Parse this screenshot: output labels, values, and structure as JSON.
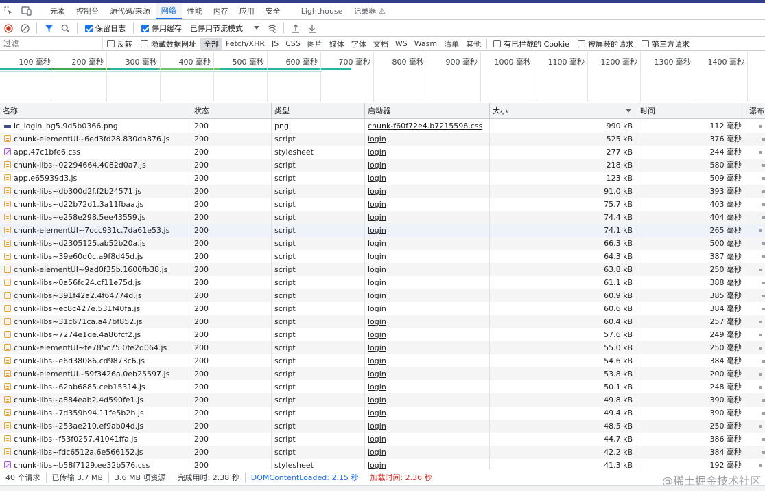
{
  "tabs": [
    {
      "label": "元素",
      "active": false
    },
    {
      "label": "控制台",
      "active": false
    },
    {
      "label": "源代码/来源",
      "active": false
    },
    {
      "label": "网络",
      "active": true
    },
    {
      "label": "性能",
      "active": false
    },
    {
      "label": "内存",
      "active": false
    },
    {
      "label": "应用",
      "active": false
    },
    {
      "label": "安全",
      "active": false
    },
    {
      "label": "Lighthouse",
      "active": false
    },
    {
      "label": "记录器 ⚠",
      "active": false
    }
  ],
  "toolbar": {
    "preserve_log": "保留日志",
    "disable_cache": "停用缓存",
    "throttle": "已停用节流模式"
  },
  "filter": {
    "placeholder": "过滤",
    "invert": "反转",
    "hide_data_urls": "隐藏数据网址",
    "types": [
      "全部",
      "Fetch/XHR",
      "JS",
      "CSS",
      "图片",
      "媒体",
      "字体",
      "文档",
      "WS",
      "Wasm",
      "清单",
      "其他"
    ],
    "active_type": "全部",
    "blocked_cookies": "有已拦截的 Cookie",
    "blocked_requests": "被屏蔽的请求",
    "third_party": "第三方请求"
  },
  "overview": {
    "ticks": [
      "100 毫秒",
      "200 毫秒",
      "300 毫秒",
      "400 毫秒",
      "500 毫秒",
      "600 毫秒",
      "700 毫秒",
      "800 毫秒",
      "900 毫秒",
      "1000 毫秒",
      "1100 毫秒",
      "1200 毫秒",
      "1300 毫秒",
      "1400 毫秒"
    ]
  },
  "columns": {
    "name": "名称",
    "status": "状态",
    "type": "类型",
    "initiator": "启动器",
    "size": "大小",
    "time": "时间",
    "waterfall": "瀑布"
  },
  "rows": [
    {
      "name": "ic_login_bg5.9d5b0366.png",
      "status": "200",
      "type": "png",
      "initiator": "chunk-f60f72e4.b7215596.css",
      "size": "990 kB",
      "time": "112 毫秒"
    },
    {
      "name": "chunk-elementUI~6ed3fd28.830da876.js",
      "status": "200",
      "type": "script",
      "initiator": "login",
      "size": "525 kB",
      "time": "376 毫秒"
    },
    {
      "name": "app.47c1bfe6.css",
      "status": "200",
      "type": "stylesheet",
      "initiator": "login",
      "size": "277 kB",
      "time": "244 毫秒"
    },
    {
      "name": "chunk-libs~02294664.4082d0a7.js",
      "status": "200",
      "type": "script",
      "initiator": "login",
      "size": "218 kB",
      "time": "580 毫秒"
    },
    {
      "name": "app.e65939d3.js",
      "status": "200",
      "type": "script",
      "initiator": "login",
      "size": "123 kB",
      "time": "509 毫秒"
    },
    {
      "name": "chunk-libs~db300d2f.f2b24571.js",
      "status": "200",
      "type": "script",
      "initiator": "login",
      "size": "91.0 kB",
      "time": "393 毫秒"
    },
    {
      "name": "chunk-libs~d22b72d1.3a11fbaa.js",
      "status": "200",
      "type": "script",
      "initiator": "login",
      "size": "75.7 kB",
      "time": "403 毫秒"
    },
    {
      "name": "chunk-libs~e258e298.5ee43559.js",
      "status": "200",
      "type": "script",
      "initiator": "login",
      "size": "74.4 kB",
      "time": "404 毫秒"
    },
    {
      "name": "chunk-elementUI~7occ931c.7da61e53.js",
      "status": "200",
      "type": "script",
      "initiator": "login",
      "size": "74.1 kB",
      "time": "265 毫秒"
    },
    {
      "name": "chunk-libs~d2305125.ab52b20a.js",
      "status": "200",
      "type": "script",
      "initiator": "login",
      "size": "66.3 kB",
      "time": "500 毫秒"
    },
    {
      "name": "chunk-libs~39e60d0c.a9f8d45d.js",
      "status": "200",
      "type": "script",
      "initiator": "login",
      "size": "64.3 kB",
      "time": "387 毫秒"
    },
    {
      "name": "chunk-elementUI~9ad0f35b.1600fb38.js",
      "status": "200",
      "type": "script",
      "initiator": "login",
      "size": "63.8 kB",
      "time": "250 毫秒"
    },
    {
      "name": "chunk-libs~0a56fd24.cf11e75d.js",
      "status": "200",
      "type": "script",
      "initiator": "login",
      "size": "61.1 kB",
      "time": "388 毫秒"
    },
    {
      "name": "chunk-libs~391f42a2.4f64774d.js",
      "status": "200",
      "type": "script",
      "initiator": "login",
      "size": "60.9 kB",
      "time": "385 毫秒"
    },
    {
      "name": "chunk-libs~ec8c427e.531f40fa.js",
      "status": "200",
      "type": "script",
      "initiator": "login",
      "size": "60.6 kB",
      "time": "384 毫秒"
    },
    {
      "name": "chunk-libs~31c671ca.a47bf852.js",
      "status": "200",
      "type": "script",
      "initiator": "login",
      "size": "60.4 kB",
      "time": "257 毫秒"
    },
    {
      "name": "chunk-libs~7274e1de.4a86fcf2.js",
      "status": "200",
      "type": "script",
      "initiator": "login",
      "size": "57.6 kB",
      "time": "249 毫秒"
    },
    {
      "name": "chunk-elementUI~fe785c75.0fe2d064.js",
      "status": "200",
      "type": "script",
      "initiator": "login",
      "size": "55.0 kB",
      "time": "250 毫秒"
    },
    {
      "name": "chunk-libs~e6d38086.cd9873c6.js",
      "status": "200",
      "type": "script",
      "initiator": "login",
      "size": "54.6 kB",
      "time": "384 毫秒"
    },
    {
      "name": "chunk-elementUI~59f3426a.0eb25597.js",
      "status": "200",
      "type": "script",
      "initiator": "login",
      "size": "53.8 kB",
      "time": "200 毫秒"
    },
    {
      "name": "chunk-libs~62ab6885.ceb15314.js",
      "status": "200",
      "type": "script",
      "initiator": "login",
      "size": "50.1 kB",
      "time": "248 毫秒"
    },
    {
      "name": "chunk-libs~a884eab2.4d590fe1.js",
      "status": "200",
      "type": "script",
      "initiator": "login",
      "size": "49.8 kB",
      "time": "390 毫秒"
    },
    {
      "name": "chunk-libs~7d359b94.11fe5b2b.js",
      "status": "200",
      "type": "script",
      "initiator": "login",
      "size": "49.4 kB",
      "time": "390 毫秒"
    },
    {
      "name": "chunk-libs~253ae210.ef9ab04d.js",
      "status": "200",
      "type": "script",
      "initiator": "login",
      "size": "48.5 kB",
      "time": "250 毫秒"
    },
    {
      "name": "chunk-libs~f53f0257.41041ffa.js",
      "status": "200",
      "type": "script",
      "initiator": "login",
      "size": "44.7 kB",
      "time": "386 毫秒"
    },
    {
      "name": "chunk-libs~fdc6512a.6e566152.js",
      "status": "200",
      "type": "script",
      "initiator": "login",
      "size": "42.2 kB",
      "time": "384 毫秒"
    },
    {
      "name": "chunk-libs~b58f7129.ee32b576.css",
      "status": "200",
      "type": "stylesheet",
      "initiator": "login",
      "size": "41.3 kB",
      "time": "192 毫秒"
    }
  ],
  "status": {
    "requests": "40 个请求",
    "transferred": "已传输 3.7 MB",
    "resources": "3.6 MB 项资源",
    "finish": "完成用时: 2.38 秒",
    "dcl": "DOMContentLoaded: 2.15 秒",
    "load": "加载时间: 2.36 秒"
  },
  "watermark": "@稀土掘金技术社区",
  "colors": {
    "accent": "#1a73e8",
    "load_red": "#d93025",
    "script_icon": "#e8a33c",
    "css_icon": "#a259d9"
  }
}
